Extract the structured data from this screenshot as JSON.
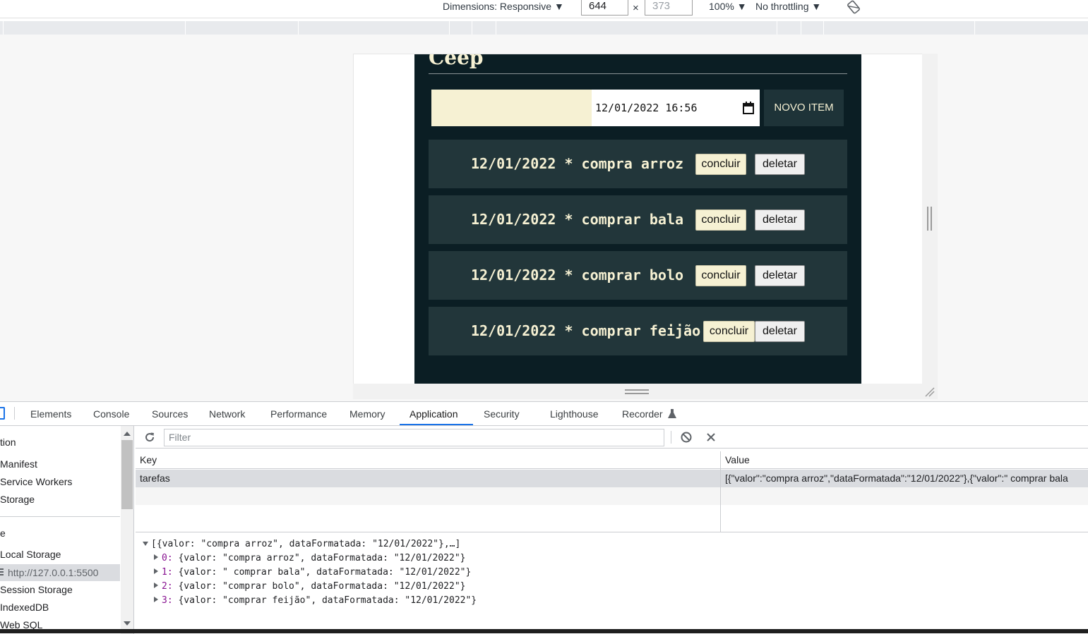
{
  "device_toolbar": {
    "dimensions_label": "Dimensions: Responsive ▼",
    "width_value": "644",
    "times": "×",
    "height_placeholder": "373",
    "zoom": "100% ▼",
    "throttling": "No throttling ▼"
  },
  "app": {
    "title": "Ceep",
    "date_input_value": "12/01/2022 16:56",
    "new_item_label": "NOVO ITEM",
    "tasks": [
      {
        "text": "12/01/2022 * compra arroz",
        "done_label": "concluir",
        "delete_label": "deletar"
      },
      {
        "text": "12/01/2022 * comprar bala",
        "done_label": "concluir",
        "delete_label": "deletar"
      },
      {
        "text": "12/01/2022 * comprar bolo",
        "done_label": "concluir",
        "delete_label": "deletar"
      },
      {
        "text": "12/01/2022 * comprar feijão",
        "done_label": "concluir",
        "delete_label": "deletar"
      }
    ]
  },
  "devtools": {
    "tabs": [
      "Elements",
      "Console",
      "Sources",
      "Network",
      "Performance",
      "Memory",
      "Application",
      "Security",
      "Lighthouse",
      "Recorder"
    ],
    "active_tab": "Application",
    "sidebar": {
      "items": [
        "tion",
        "Manifest",
        "Service Workers",
        "Storage",
        "e",
        "Local Storage",
        "http://127.0.0.1:5500",
        "Session Storage",
        "IndexedDB",
        "Web SQL"
      ]
    },
    "filter_placeholder": "Filter",
    "table": {
      "headers": [
        "Key",
        "Value"
      ],
      "rows": [
        {
          "key": "tarefas",
          "value": "[{\"valor\":\"compra arroz\",\"dataFormatada\":\"12/01/2022\"},{\"valor\":\" comprar bala"
        }
      ]
    },
    "preview": {
      "root": "[{valor: \"compra arroz\", dataFormatada: \"12/01/2022\"},…]",
      "items": [
        {
          "index": "0:",
          "text": "{valor: \"compra arroz\", dataFormatada: \"12/01/2022\"}"
        },
        {
          "index": "1:",
          "text": "{valor: \" comprar bala\", dataFormatada: \"12/01/2022\"}"
        },
        {
          "index": "2:",
          "text": "{valor: \"comprar bolo\", dataFormatada: \"12/01/2022\"}"
        },
        {
          "index": "3:",
          "text": "{valor: \"comprar feijão\", dataFormatada: \"12/01/2022\"}"
        }
      ]
    }
  },
  "colors": {
    "app_bg": "#0b1e24",
    "task_bg": "#22363a",
    "cream": "#f6f1d3",
    "devtools_accent": "#1a73e8"
  }
}
